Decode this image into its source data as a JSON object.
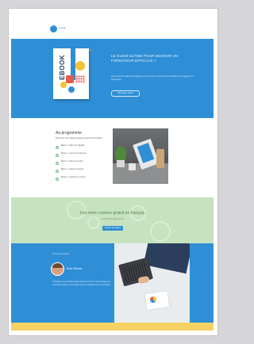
{
  "colors": {
    "primary_blue": "#2f8fd6",
    "green_band": "#c5e3bf",
    "yellow_footer": "#f6d264",
    "accent_yellow": "#f2c23a",
    "accent_red": "#e45b4a"
  },
  "header": {
    "logo_icon": "circle-logo-icon",
    "logo_text": "digital"
  },
  "hero": {
    "book_title": "EBOOK",
    "heading": "LE GUIDE ULTIME POUR DEVENIR UN FORMATEUR EFFICACE ?",
    "text": "Découvrez les meilleures pratiques pour concevoir et animer des formations qui engagent vos apprenants.",
    "button_label": "Télécharger l'ebook"
  },
  "programme": {
    "title": "Au programme",
    "intro": "Découvrez les 5 étapes clés pour réussir vos formations",
    "items": [
      "Étape 1 : définir vos objectifs",
      "Étape 2 : concevoir le parcours",
      "Étape 3 : animer la session",
      "Étape 4 : évaluer les acquis",
      "Étape 5 : améliorer en continu"
    ]
  },
  "green_band": {
    "heading": "Lire notre contenu gratuit en français",
    "subtitle": "Accès illimité | Mises à jour",
    "button_label": "Accéder au contenu"
  },
  "author": {
    "label": "À propos de l'auteur",
    "name": "Eric Simon",
    "bio": "Formateur et consultant depuis plus de 10 ans, il accompagne les entreprises dans la conception de leurs programmes de formation."
  }
}
